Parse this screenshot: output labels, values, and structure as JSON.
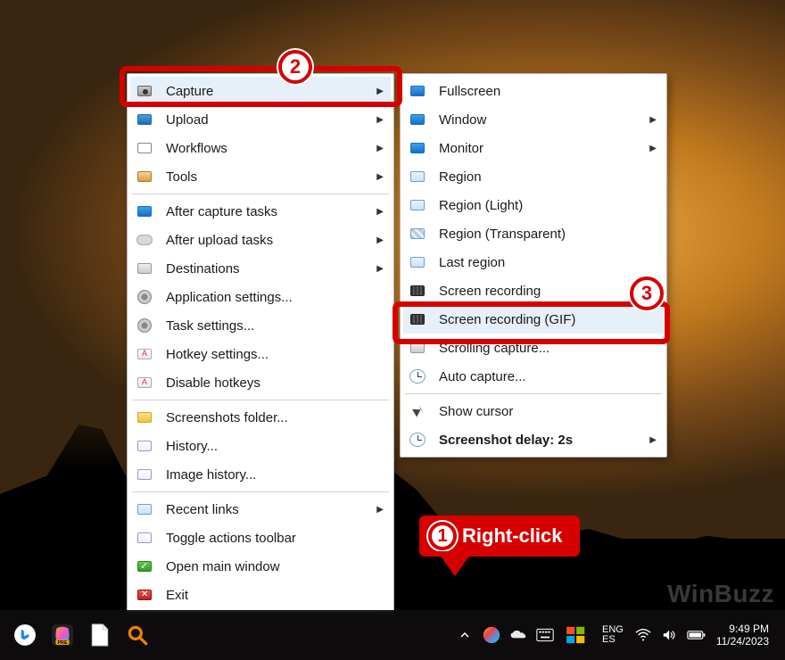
{
  "desktop": {
    "watermark": "WinBuzz"
  },
  "callouts": {
    "n1": "1",
    "n2": "2",
    "n3": "3",
    "rc_label": "Right-click"
  },
  "menu": {
    "items": [
      {
        "label": "Capture",
        "icon": "camera",
        "arrow": true,
        "hl": true
      },
      {
        "label": "Upload",
        "icon": "upload",
        "arrow": true
      },
      {
        "label": "Workflows",
        "icon": "grid",
        "arrow": true
      },
      {
        "label": "Tools",
        "icon": "tools",
        "arrow": true
      },
      "sep",
      {
        "label": "After capture tasks",
        "icon": "blue",
        "arrow": true
      },
      {
        "label": "After upload tasks",
        "icon": "cloud",
        "arrow": true
      },
      {
        "label": "Destinations",
        "icon": "gray",
        "arrow": true
      },
      {
        "label": "Application settings...",
        "icon": "gear"
      },
      {
        "label": "Task settings...",
        "icon": "gear"
      },
      {
        "label": "Hotkey settings...",
        "icon": "key"
      },
      {
        "label": "Disable hotkeys",
        "icon": "key"
      },
      "sep",
      {
        "label": "Screenshots folder...",
        "icon": "folder"
      },
      {
        "label": "History...",
        "icon": "doc"
      },
      {
        "label": "Image history...",
        "icon": "doc"
      },
      "sep",
      {
        "label": "Recent links",
        "icon": "chain",
        "arrow": true
      },
      {
        "label": "Toggle actions toolbar",
        "icon": "doc"
      },
      {
        "label": "Open main window",
        "icon": "check"
      },
      {
        "label": "Exit",
        "icon": "x"
      }
    ]
  },
  "submenu": {
    "items": [
      {
        "label": "Fullscreen",
        "icon": "blue"
      },
      {
        "label": "Window",
        "icon": "blue",
        "arrow": true
      },
      {
        "label": "Monitor",
        "icon": "blue",
        "arrow": true
      },
      {
        "label": "Region",
        "icon": ""
      },
      {
        "label": "Region (Light)",
        "icon": ""
      },
      {
        "label": "Region (Transparent)",
        "icon": "patt"
      },
      {
        "label": "Last region",
        "icon": ""
      },
      {
        "label": "Screen recording",
        "icon": "film"
      },
      {
        "label": "Screen recording (GIF)",
        "icon": "film",
        "hl": true
      },
      {
        "label": "Scrolling capture...",
        "icon": "gray"
      },
      {
        "label": "Auto capture...",
        "icon": "clock"
      },
      "sep",
      {
        "label": "Show cursor",
        "icon": "cursor"
      },
      {
        "label": "Screenshot delay: 2s",
        "icon": "clock",
        "arrow": true,
        "bold": true
      }
    ]
  },
  "taskbar": {
    "lang1": "ENG",
    "lang2": "ES",
    "time": "9:49 PM",
    "date": "11/24/2023"
  }
}
